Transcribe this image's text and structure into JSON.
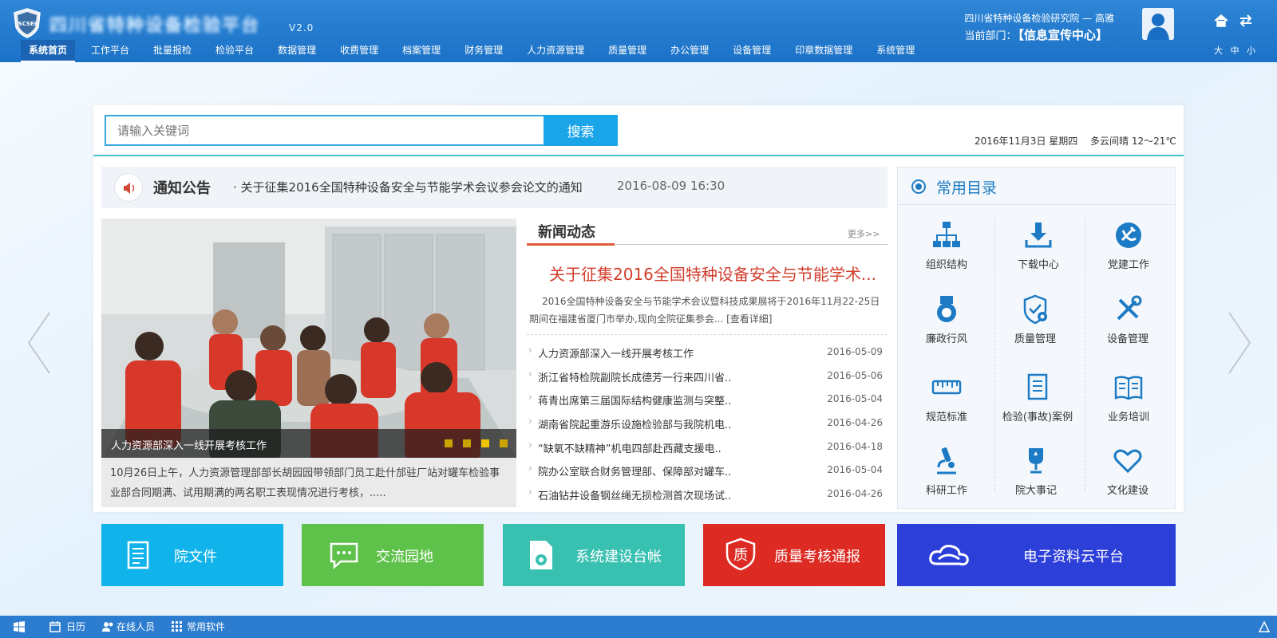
{
  "header": {
    "app_title": "四川省特种设备检验平台",
    "version": "V2.0",
    "user_org": "四川省特种设备检验研究院 — 高雅",
    "dept_label": "当前部门：",
    "dept_name": "【信息宣传中心】",
    "font_sizes": [
      "大",
      "中",
      "小"
    ]
  },
  "nav": [
    "系统首页",
    "工作平台",
    "批量报检",
    "检验平台",
    "数据管理",
    "收费管理",
    "档案管理",
    "财务管理",
    "人力资源管理",
    "质量管理",
    "办公管理",
    "设备管理",
    "印章数据管理",
    "系统管理"
  ],
  "search": {
    "placeholder": "请输入关键词",
    "button": "搜索"
  },
  "date": "2016年11月3日 星期四",
  "weather": "多云间晴 12～21℃",
  "notice": {
    "title": "通知公告",
    "text": "· 关于征集2016全国特种设备安全与节能学术会议参会论文的通知",
    "time": "2016-08-09 16:30"
  },
  "photo": {
    "caption": "人力资源部深入一线开展考核工作",
    "description": "10月26日上午，人力资源管理部部长胡园园带领部门员工赴什邡驻厂站对罐车检验事业部合同期满、试用期满的两名职工表现情况进行考核，.....",
    "slides": 4,
    "active_slide": 3
  },
  "news": {
    "title": "新闻动态",
    "more": "更多>>",
    "headline": "关于征集2016全国特种设备安全与节能学术...",
    "summary": "2016全国特种设备安全与节能学术会议暨科技成果展将于2016年11月22-25日期间在福建省厦门市举办,现向全院征集参会... [查看详细]",
    "items": [
      {
        "title": "人力资源部深入一线开展考核工作",
        "date": "2016-05-09"
      },
      {
        "title": "浙江省特检院副院长成德芳一行来四川省..",
        "date": "2016-05-06"
      },
      {
        "title": "蒋青出席第三届国际结构健康监测与突整..",
        "date": "2016-05-04"
      },
      {
        "title": "湖南省院起重游乐设施检验部与我院机电..",
        "date": "2016-04-26"
      },
      {
        "title": "“缺氧不缺精神”机电四部赴西藏支援电..",
        "date": "2016-04-18"
      },
      {
        "title": "院办公室联合财务管理部、保障部对罐车..",
        "date": "2016-05-04"
      },
      {
        "title": "石油钻井设备钢丝绳无损检测首次现场试..",
        "date": "2016-04-26"
      }
    ]
  },
  "catalog": {
    "title": "常用目录",
    "items": [
      {
        "label": "组织结构",
        "icon": "org-chart-icon"
      },
      {
        "label": "下载中心",
        "icon": "download-icon"
      },
      {
        "label": "党建工作",
        "icon": "party-emblem-icon"
      },
      {
        "label": "廉政行风",
        "icon": "medal-icon"
      },
      {
        "label": "质量管理",
        "icon": "shield-gear-icon"
      },
      {
        "label": "设备管理",
        "icon": "tools-icon"
      },
      {
        "label": "规范标准",
        "icon": "ruler-icon"
      },
      {
        "label": "检验(事故)案例",
        "icon": "document-list-icon"
      },
      {
        "label": "业务培训",
        "icon": "open-book-icon"
      },
      {
        "label": "科研工作",
        "icon": "microscope-icon"
      },
      {
        "label": "院大事记",
        "icon": "trophy-icon"
      },
      {
        "label": "文化建设",
        "icon": "heart-icon"
      }
    ]
  },
  "tiles": [
    {
      "label": "院文件",
      "color": "#11b4ea",
      "icon": "document-icon"
    },
    {
      "label": "交流园地",
      "color": "#5ec24a",
      "icon": "chat-icon"
    },
    {
      "label": "系统建设台帐",
      "color": "#38c0b0",
      "icon": "gear-document-icon"
    },
    {
      "label": "质量考核通报",
      "color": "#dd2b24",
      "icon": "quality-badge-icon"
    },
    {
      "label": "电子资料云平台",
      "color": "#2d3fd9",
      "icon": "cloud-icon"
    }
  ],
  "taskbar": {
    "calendar": "日历",
    "online": "在线人员",
    "software": "常用软件"
  }
}
